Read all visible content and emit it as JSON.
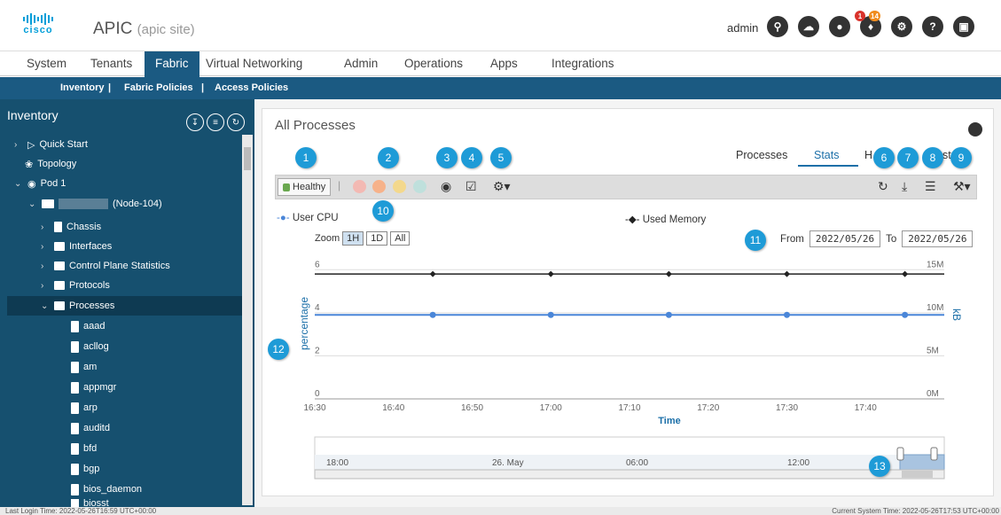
{
  "header": {
    "logo_text": "cisco",
    "app_title": "APIC",
    "site": "(apic site)",
    "user": "admin",
    "alert_badge_red": "1",
    "alert_badge_orange": "14"
  },
  "tabs": [
    "System",
    "Tenants",
    "Fabric",
    "Virtual Networking",
    "Admin",
    "Operations",
    "Apps",
    "Integrations"
  ],
  "subnav": [
    "Inventory",
    "|",
    "Fabric Policies",
    "|",
    "Access Policies"
  ],
  "sidebar": {
    "title": "Inventory",
    "items": [
      {
        "label": "Quick Start"
      },
      {
        "label": "Topology"
      },
      {
        "label": "Pod 1"
      },
      {
        "label": "(Node-104)"
      },
      {
        "label": "Chassis"
      },
      {
        "label": "Interfaces"
      },
      {
        "label": "Control Plane Statistics"
      },
      {
        "label": "Protocols"
      },
      {
        "label": "Processes"
      },
      {
        "label": "aaad"
      },
      {
        "label": "acllog"
      },
      {
        "label": "am"
      },
      {
        "label": "appmgr"
      },
      {
        "label": "arp"
      },
      {
        "label": "auditd"
      },
      {
        "label": "bfd"
      },
      {
        "label": "bgp"
      },
      {
        "label": "bios_daemon"
      },
      {
        "label": "biosst"
      }
    ]
  },
  "main": {
    "title": "All Processes",
    "subtabs": [
      "Processes",
      "Stats",
      "H",
      "sto"
    ],
    "health": "Healthy",
    "legend_cpu": "User CPU",
    "legend_mem": "Used Memory",
    "zoom_label": "Zoom",
    "zoom_opts": [
      "1H",
      "1D",
      "All"
    ],
    "from_label": "From",
    "from_value": "2022/05/26",
    "to_label": "To",
    "to_value": "2022/05/26",
    "callouts": [
      "1",
      "2",
      "3",
      "4",
      "5",
      "6",
      "7",
      "8",
      "9",
      "10",
      "11",
      "12",
      "13"
    ]
  },
  "chart_data": {
    "type": "line",
    "xlabel": "Time",
    "ylabel": "percentage",
    "y2label": "kB",
    "x_ticks": [
      "16:30",
      "16:40",
      "16:50",
      "17:00",
      "17:10",
      "17:20",
      "17:30",
      "17:40"
    ],
    "y_ticks": [
      "0",
      "2",
      "4",
      "6"
    ],
    "y2_ticks": [
      "0M",
      "5M",
      "10M",
      "15M"
    ],
    "ylim": [
      0,
      7
    ],
    "series": [
      {
        "name": "User CPU",
        "color": "#4a86d8",
        "x": [
          16.75,
          17.0,
          17.25,
          17.5,
          17.75
        ],
        "values": [
          3.9,
          3.9,
          3.9,
          3.9,
          3.9
        ]
      },
      {
        "name": "Used Memory",
        "color": "#222222",
        "x": [
          16.75,
          17.0,
          17.25,
          17.5,
          17.75
        ],
        "values": [
          5.8,
          5.8,
          5.8,
          5.8,
          5.8
        ]
      }
    ],
    "navigator_ticks": [
      "18:00",
      "26. May",
      "06:00",
      "12:00"
    ]
  },
  "footer": {
    "login": "Last Login Time: 2022-05-26T16:59 UTC+00:00",
    "system": "Current System Time: 2022-05-26T17:53 UTC+00:00"
  }
}
